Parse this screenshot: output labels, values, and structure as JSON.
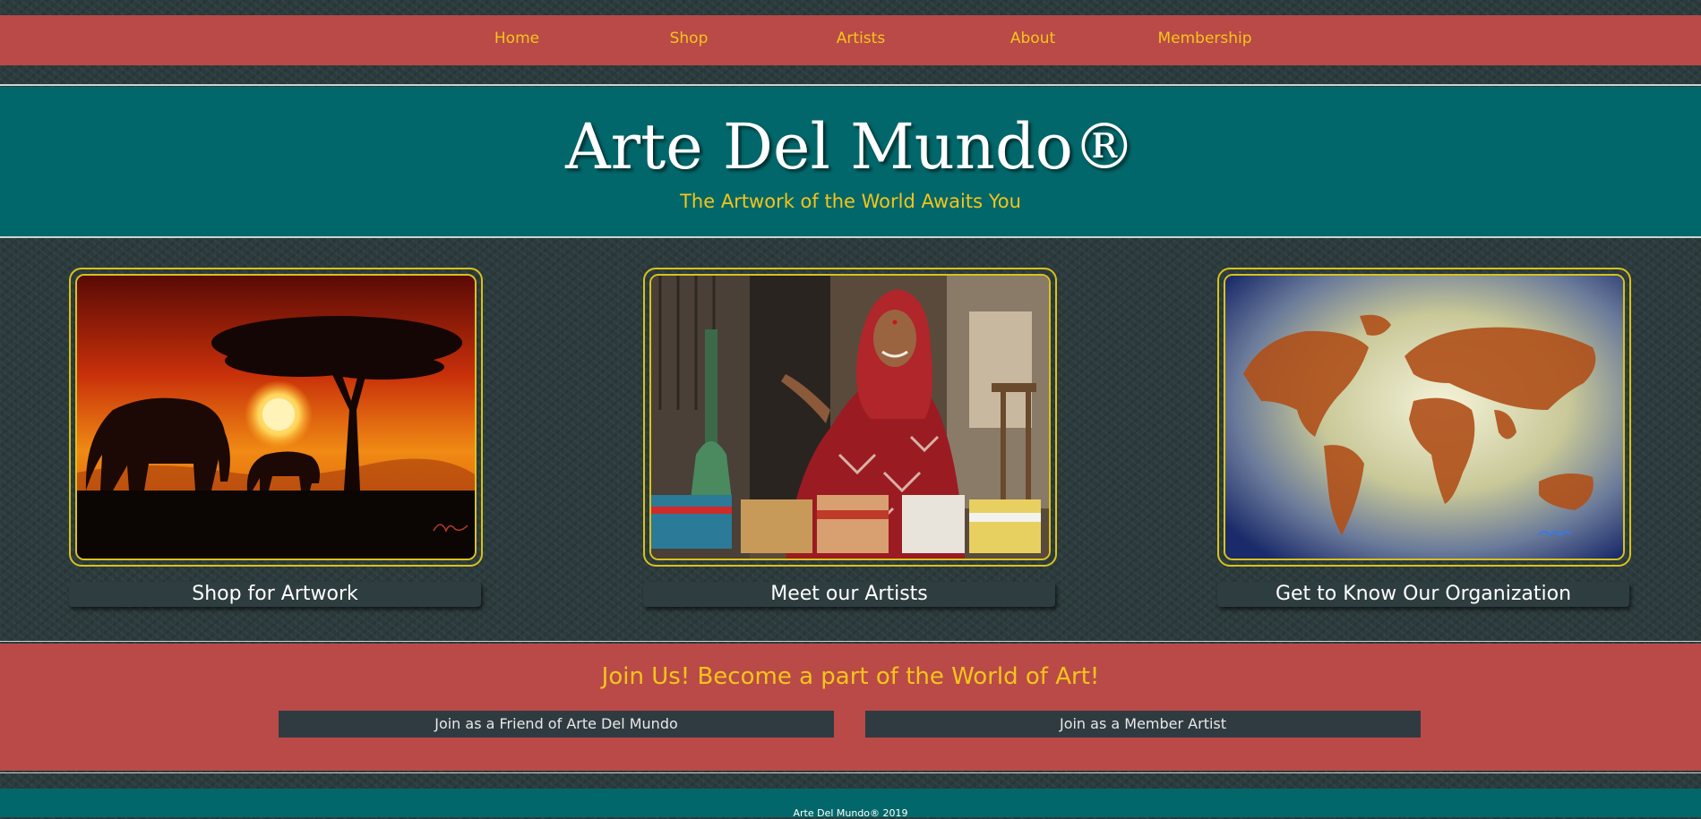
{
  "nav": {
    "items": [
      {
        "label": "Home"
      },
      {
        "label": "Shop"
      },
      {
        "label": "Artists"
      },
      {
        "label": "About"
      },
      {
        "label": "Membership"
      }
    ]
  },
  "header": {
    "title": "Arte Del Mundo®",
    "tagline": "The Artwork of the World Awaits You"
  },
  "cards": [
    {
      "image": "elephant-sunset-painting",
      "button_label": "Shop for Artwork"
    },
    {
      "image": "artisan-woman-photo",
      "button_label": "Meet our Artists"
    },
    {
      "image": "world-map-painting",
      "button_label": "Get to Know Our Organization"
    }
  ],
  "join": {
    "heading": "Join Us! Become a part of the World of Art!",
    "friend_button": "Join as a Friend of Arte Del Mundo",
    "artist_button": "Join as a Member Artist"
  },
  "footer": {
    "text": "Arte Del Mundo® 2019"
  },
  "colors": {
    "nav_bg": "#b94a48",
    "accent_yellow": "#f5c518",
    "header_teal": "#02676a",
    "page_bg": "#2b3a3c"
  }
}
